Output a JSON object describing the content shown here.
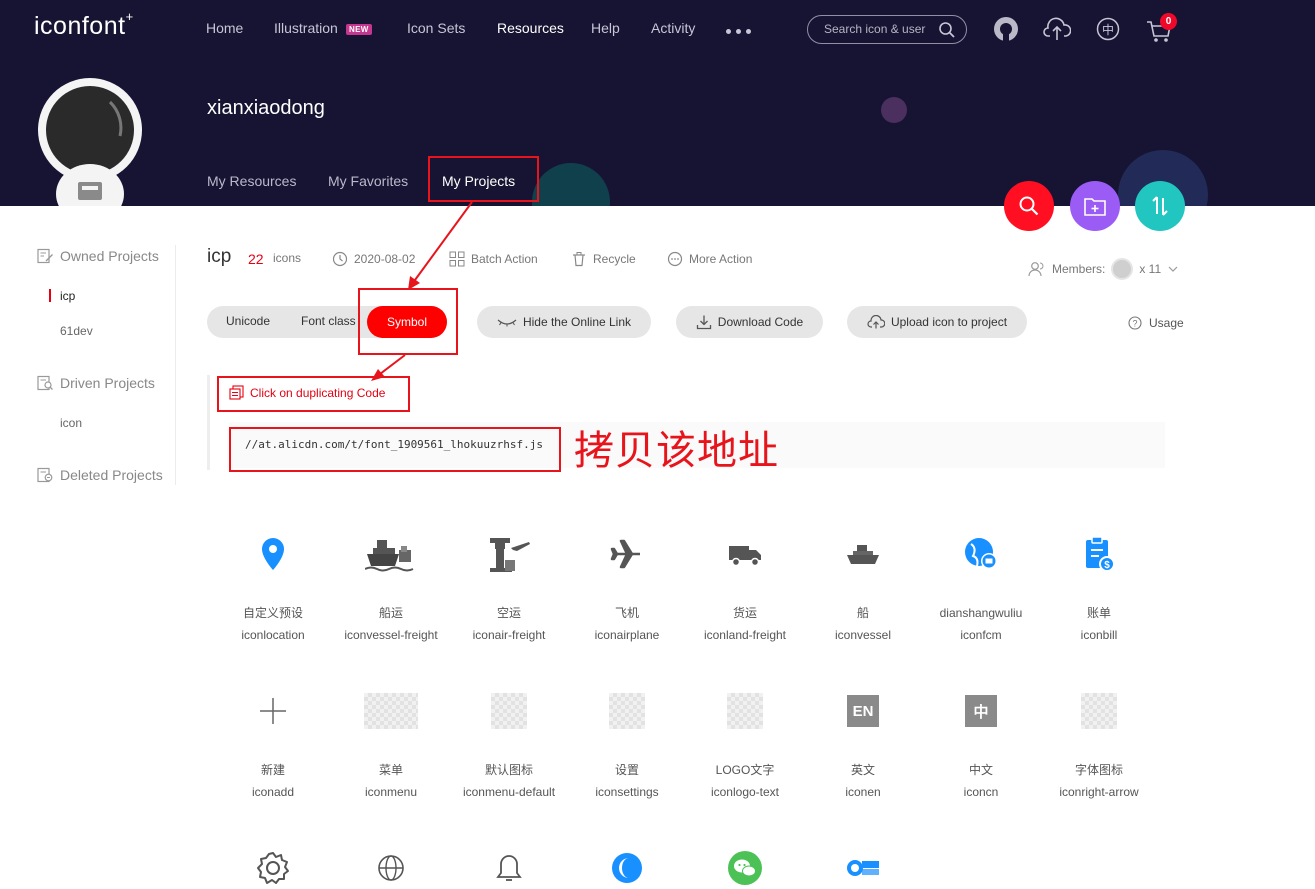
{
  "header": {
    "logo": "iconfont",
    "logo_mark": "+",
    "nav": [
      "Home",
      "Illustration",
      "Icon Sets",
      "Resources",
      "Help",
      "Activity"
    ],
    "new_badge": "NEW",
    "search_placeholder": "Search icon & user",
    "cart_count": "0",
    "icons": [
      "github-icon",
      "upload-icon",
      "language-icon",
      "cart-icon"
    ]
  },
  "profile": {
    "username": "xianxiaodong",
    "tabs": [
      "My Resources",
      "My Favorites",
      "My Projects"
    ]
  },
  "sidebar": {
    "owned_title": "Owned Projects",
    "owned_items": [
      "icp",
      "61dev"
    ],
    "driven_title": "Driven Projects",
    "driven_items": [
      "icon"
    ],
    "deleted_title": "Deleted Projects"
  },
  "project": {
    "name": "icp",
    "count": "22",
    "count_unit": "icons",
    "date": "2020-08-02",
    "batch_action": "Batch Action",
    "recycle": "Recycle",
    "more_action": "More Action",
    "members_label": "Members:",
    "members_count": "x 11"
  },
  "toolbar": {
    "modes": [
      "Unicode",
      "Font class",
      "Symbol"
    ],
    "hide_link": "Hide the Online Link",
    "download": "Download Code",
    "upload": "Upload icon to project",
    "usage": "Usage"
  },
  "code": {
    "copy_label": "Click on duplicating Code",
    "url": "//at.alicdn.com/t/font_1909561_lhokuuzrhsf.js"
  },
  "annotation": {
    "text": "拷贝该地址"
  },
  "icons_grid": [
    {
      "cn": "自定义预设",
      "code": "iconlocation"
    },
    {
      "cn": "船运",
      "code": "iconvessel-freight"
    },
    {
      "cn": "空运",
      "code": "iconair-freight"
    },
    {
      "cn": "飞机",
      "code": "iconairplane"
    },
    {
      "cn": "货运",
      "code": "iconland-freight"
    },
    {
      "cn": "船",
      "code": "iconvessel"
    },
    {
      "cn": "dianshangwuliu",
      "code": "iconfcm"
    },
    {
      "cn": "账单",
      "code": "iconbill"
    },
    {
      "cn": "新建",
      "code": "iconadd"
    },
    {
      "cn": "菜单",
      "code": "iconmenu"
    },
    {
      "cn": "默认图标",
      "code": "iconmenu-default"
    },
    {
      "cn": "设置",
      "code": "iconsettings"
    },
    {
      "cn": "LOGO文字",
      "code": "iconlogo-text"
    },
    {
      "cn": "英文",
      "code": "iconen",
      "glyph": "EN"
    },
    {
      "cn": "中文",
      "code": "iconcn",
      "glyph": "中"
    },
    {
      "cn": "字体图标",
      "code": "iconright-arrow"
    }
  ],
  "icons_row3": [
    "gear-icon",
    "globe-icon",
    "bell-icon",
    "moon-logo-icon",
    "wechat-icon",
    "city-logo-icon"
  ],
  "colors": {
    "header_bg": "#161432",
    "accent_red": "#ff0000",
    "fab_purple": "#9b5cf5",
    "fab_teal": "#22c6c0",
    "annotation_red": "#e8141c"
  }
}
